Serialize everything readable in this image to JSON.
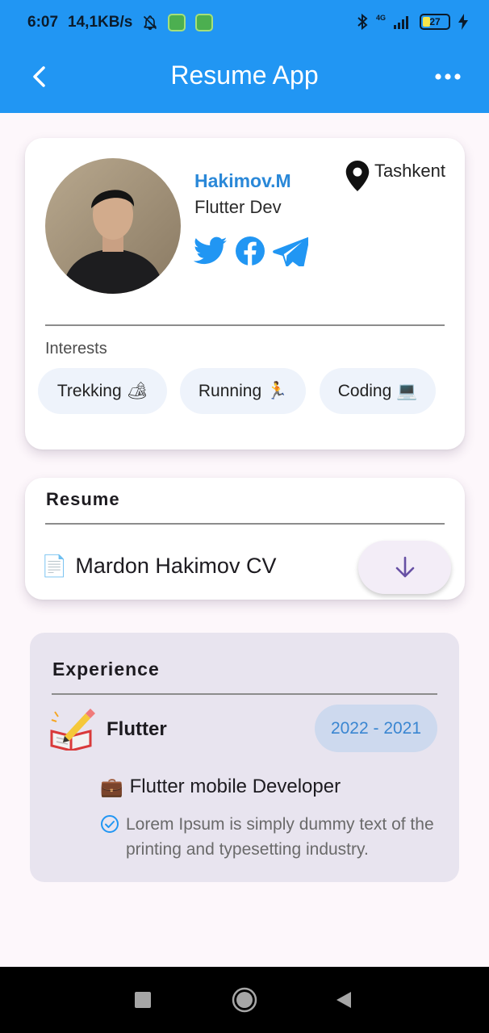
{
  "status_bar": {
    "time": "6:07",
    "speed": "14,1KB/s",
    "network": "4G",
    "battery": "27"
  },
  "app_bar": {
    "title": "Resume App"
  },
  "profile": {
    "name": "Hakimov.M",
    "role": "Flutter Dev",
    "location": "Tashkent",
    "socials": [
      "twitter-icon",
      "facebook-icon",
      "telegram-icon"
    ],
    "interests_label": "Interests",
    "interests": [
      "Trekking 🏕",
      "Running 🏃",
      "Coding 💻"
    ]
  },
  "resume": {
    "title": "Resume",
    "file_icon": "📄",
    "file_name": "Mardon Hakimov CV"
  },
  "experience": {
    "title": "Experience",
    "icon": "📝",
    "name": "Flutter",
    "years": "2022 - 2021",
    "job_icon": "💼",
    "job": "Flutter mobile Developer",
    "description": "Lorem Ipsum is simply dummy text of the printing and typesetting industry."
  },
  "colors": {
    "primary": "#2196f3",
    "name_blue": "#2a88d8",
    "chip_bg": "#eef3fb",
    "exp_bg": "#e8e4ef",
    "download_arrow": "#6750a4"
  }
}
